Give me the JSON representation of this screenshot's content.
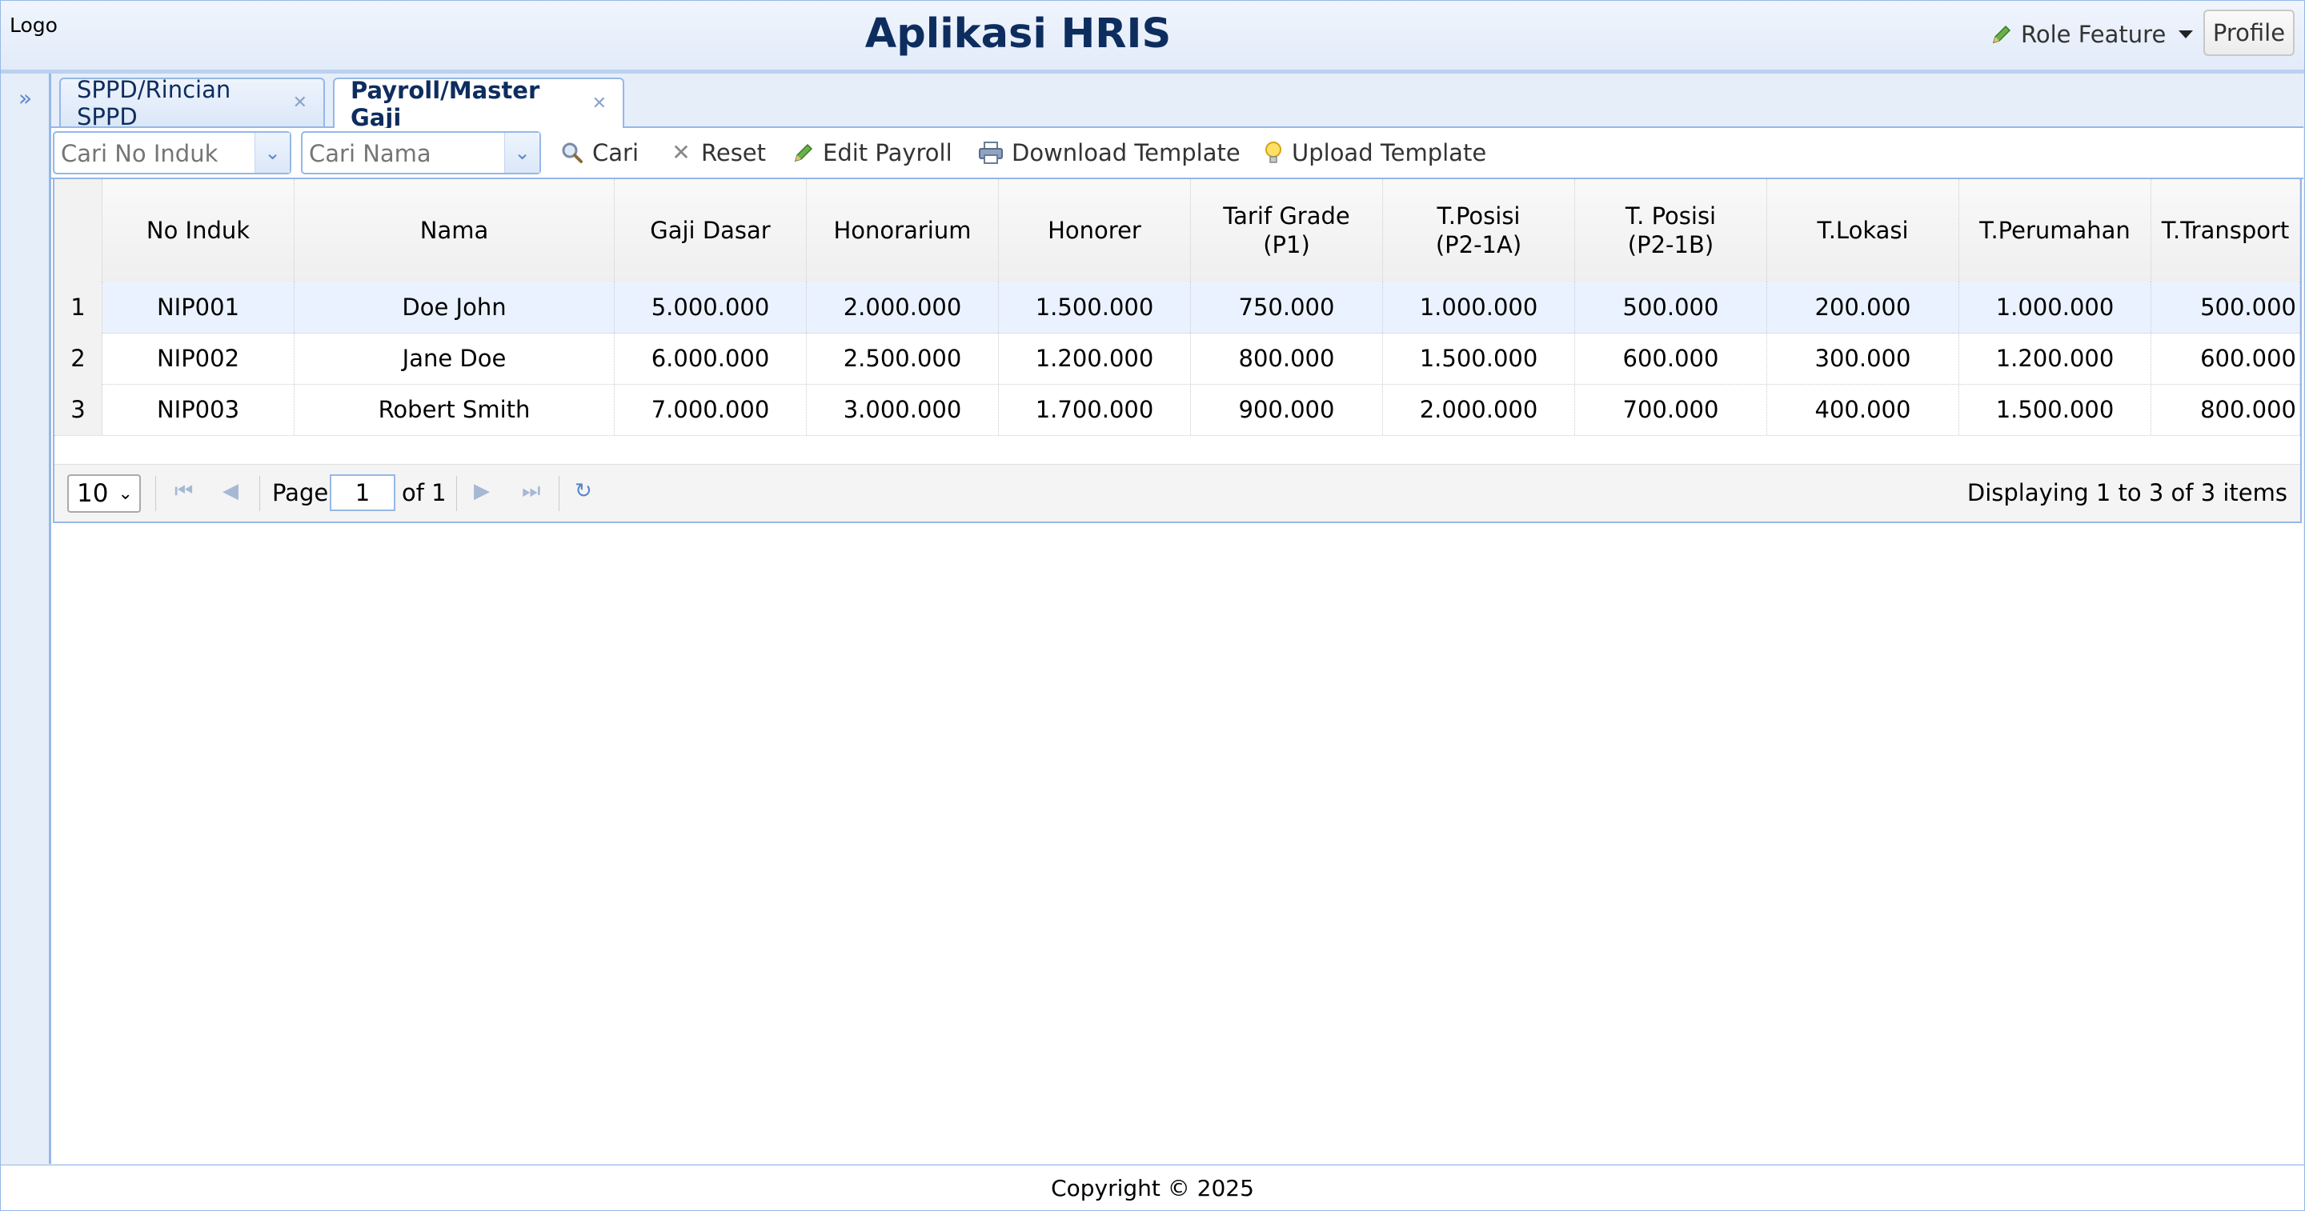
{
  "header": {
    "logo": "Logo",
    "title": "Aplikasi HRIS",
    "role_feature": "Role Feature",
    "profile": "Profile"
  },
  "tabs": [
    {
      "label": "SPPD/Rincian SPPD",
      "active": false
    },
    {
      "label": "Payroll/Master Gaji",
      "active": true
    }
  ],
  "toolbar": {
    "search_no_induk_placeholder": "Cari No Induk",
    "search_nama_placeholder": "Cari Nama",
    "cari": "Cari",
    "reset": "Reset",
    "edit_payroll": "Edit Payroll",
    "download_template": "Download Template",
    "upload_template": "Upload Template"
  },
  "grid": {
    "columns": [
      "No Induk",
      "Nama",
      "Gaji Dasar",
      "Honorarium",
      "Honorer",
      "Tarif Grade\n(P1)",
      "T.Posisi\n(P2-1A)",
      "T. Posisi\n(P2-1B)",
      "T.Lokasi",
      "T.Perumahan",
      "T.Transport"
    ],
    "rows": [
      {
        "rn": "1",
        "cells": [
          "NIP001",
          "Doe John",
          "5.000.000",
          "2.000.000",
          "1.500.000",
          "750.000",
          "1.000.000",
          "500.000",
          "200.000",
          "1.000.000",
          "500.000"
        ]
      },
      {
        "rn": "2",
        "cells": [
          "NIP002",
          "Jane Doe",
          "6.000.000",
          "2.500.000",
          "1.200.000",
          "800.000",
          "1.500.000",
          "600.000",
          "300.000",
          "1.200.000",
          "600.000"
        ]
      },
      {
        "rn": "3",
        "cells": [
          "NIP003",
          "Robert Smith",
          "7.000.000",
          "3.000.000",
          "1.700.000",
          "900.000",
          "2.000.000",
          "700.000",
          "400.000",
          "1.500.000",
          "800.000"
        ]
      }
    ]
  },
  "pager": {
    "page_size": "10",
    "page_label": "Page",
    "page_value": "1",
    "of_label": "of 1",
    "displaying": "Displaying 1 to 3 of 3 items"
  },
  "footer": {
    "copyright": "Copyright © 2025"
  },
  "colors": {
    "accent": "#0e2d5f",
    "border": "#95b8e7",
    "panel_bg": "#e6eefa"
  }
}
